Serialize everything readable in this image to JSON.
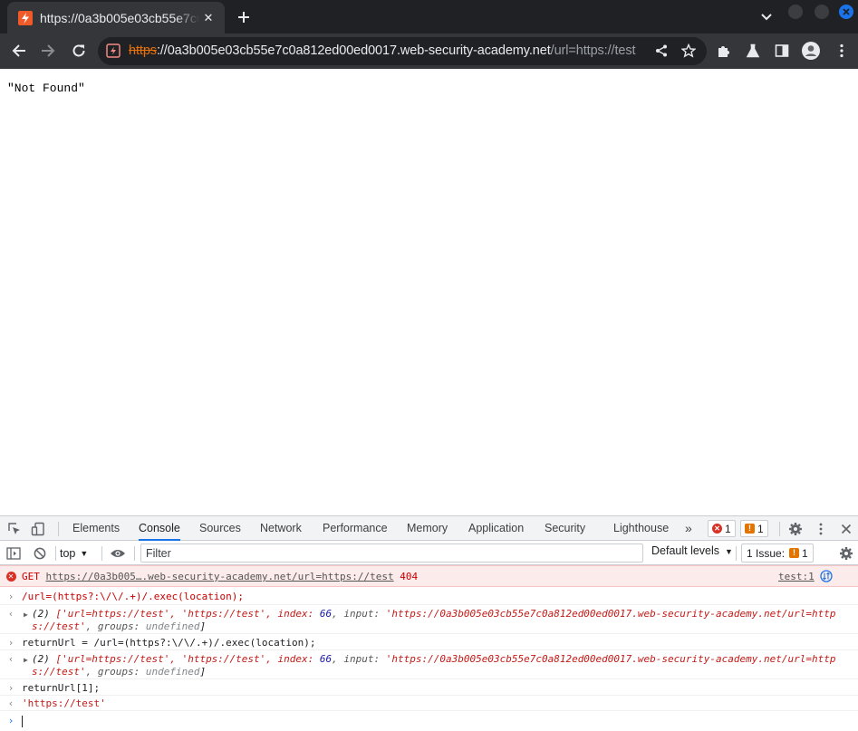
{
  "browser": {
    "tab": {
      "title": "https://0a3b005e03cb55e7c0a812ed00ed0017.web-security-academy.net/url=https://test",
      "favicon": "web-security-academy-bolt-icon",
      "accent": "#f05a28"
    },
    "address_bar": {
      "scheme": "https",
      "host_rest": "://0a3b005e03cb55e7c0a812ed00ed0017.web-security-academy.net",
      "path": "/url=https://test",
      "security": "not-secure-warning-icon"
    },
    "toolbar_icons": [
      "back-icon",
      "forward-icon",
      "reload-icon",
      "share-icon",
      "bookmark-star-icon",
      "extensions-puzzle-icon",
      "labs-flask-icon",
      "side-panel-icon",
      "profile-avatar-icon",
      "kebab-menu-icon"
    ]
  },
  "page": {
    "body_text": "\"Not Found\""
  },
  "devtools": {
    "tabs": [
      "Elements",
      "Console",
      "Sources",
      "Network",
      "Performance",
      "Memory",
      "Application",
      "Security",
      "Lighthouse"
    ],
    "active_tab": "Console",
    "more_tabs": "»",
    "error_count": "1",
    "warning_count": "1",
    "context": "top",
    "filter_placeholder": "Filter",
    "levels_label": "Default levels",
    "issues_label": "1 Issue:",
    "issues_count": "1",
    "console": {
      "error": {
        "method": "GET",
        "url": "https://0a3b005….web-security-academy.net/url=https://test",
        "status": "404",
        "source": "test:1"
      },
      "input1": "/url=(https?:\\/\\/.+)/.exec(location);",
      "output1_line1": {
        "count": "(2)",
        "open": "['url=https://test', 'https://test', index: ",
        "index": "66",
        "mid": ", input: ",
        "input_val": "'https://0a3b005e03cb55e7c0a812ed00ed0017.web-security-academy.net/url=http"
      },
      "output1_line2": {
        "cont": "s://test'",
        "groups_label": ", groups: ",
        "groups_val": "undefined",
        "close": "]"
      },
      "input2": "returnUrl = /url=(https?:\\/\\/.+)/.exec(location);",
      "input3": "returnUrl[1];",
      "result3": "'https://test'"
    }
  }
}
